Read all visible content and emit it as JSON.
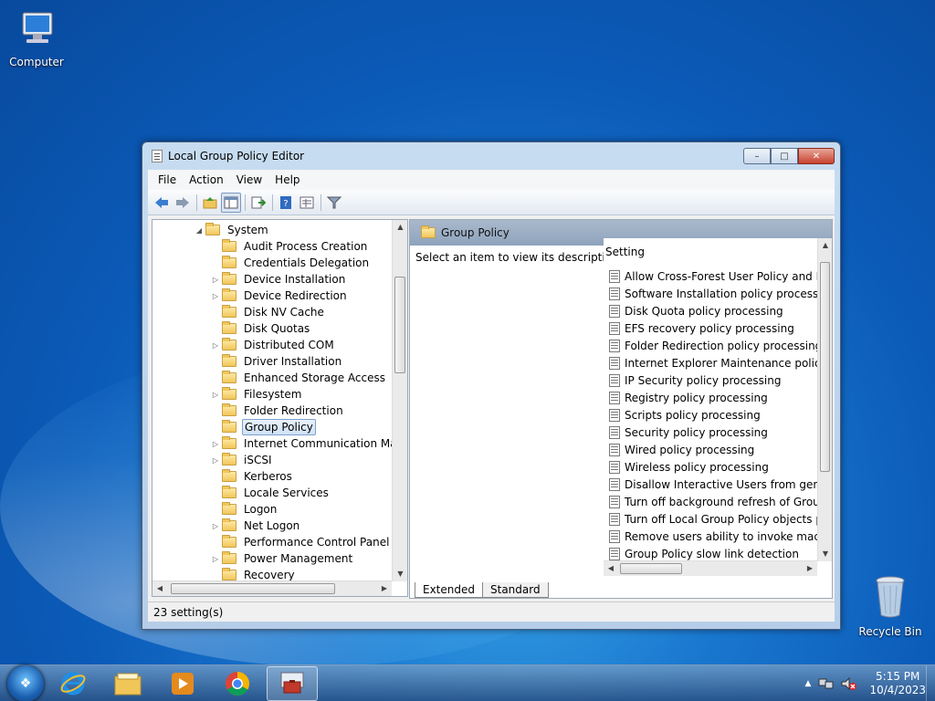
{
  "desktop": {
    "icons": [
      {
        "label": "Computer"
      },
      {
        "label": "Recycle Bin"
      }
    ]
  },
  "window": {
    "title": "Local Group Policy Editor",
    "buttons": {
      "minimize": "–",
      "maximize": "□",
      "close": "✕"
    },
    "menu": [
      "File",
      "Action",
      "View",
      "Help"
    ],
    "toolbar_icons": [
      "back-arrow-icon",
      "forward-arrow-icon",
      "up-folder-icon",
      "show-hide-console-tree-icon",
      "export-list-icon",
      "help-icon",
      "properties-icon",
      "filter-icon"
    ]
  },
  "tree": {
    "root": "System",
    "items": [
      {
        "label": "Audit Process Creation",
        "expandable": false
      },
      {
        "label": "Credentials Delegation",
        "expandable": false
      },
      {
        "label": "Device Installation",
        "expandable": true
      },
      {
        "label": "Device Redirection",
        "expandable": true
      },
      {
        "label": "Disk NV Cache",
        "expandable": false
      },
      {
        "label": "Disk Quotas",
        "expandable": false
      },
      {
        "label": "Distributed COM",
        "expandable": true
      },
      {
        "label": "Driver Installation",
        "expandable": false
      },
      {
        "label": "Enhanced Storage Access",
        "expandable": false
      },
      {
        "label": "Filesystem",
        "expandable": true
      },
      {
        "label": "Folder Redirection",
        "expandable": false
      },
      {
        "label": "Group Policy",
        "expandable": false,
        "selected": true
      },
      {
        "label": "Internet Communication Man",
        "expandable": true
      },
      {
        "label": "iSCSI",
        "expandable": true
      },
      {
        "label": "Kerberos",
        "expandable": false
      },
      {
        "label": "Locale Services",
        "expandable": false
      },
      {
        "label": "Logon",
        "expandable": false
      },
      {
        "label": "Net Logon",
        "expandable": true
      },
      {
        "label": "Performance Control Panel",
        "expandable": false
      },
      {
        "label": "Power Management",
        "expandable": true
      },
      {
        "label": "Recovery",
        "expandable": false
      }
    ]
  },
  "details": {
    "header": "Group Policy",
    "description": "Select an item to view its description.",
    "column": "Setting",
    "settings": [
      "Allow Cross-Forest User Policy and Roar",
      "Software Installation policy processing",
      "Disk Quota policy processing",
      "EFS recovery policy processing",
      "Folder Redirection policy processing",
      "Internet Explorer Maintenance policy pro",
      "IP Security policy processing",
      "Registry policy processing",
      "Scripts policy processing",
      "Security policy processing",
      "Wired policy processing",
      "Wireless policy processing",
      "Disallow Interactive Users from generati",
      "Turn off background refresh of Group P",
      "Turn off Local Group Policy objects proc",
      "Remove users ability to invoke machine",
      "Group Policy slow link detection"
    ],
    "tabs": [
      "Extended",
      "Standard"
    ]
  },
  "status": "23 setting(s)",
  "taskbar": {
    "apps": [
      "windows-explorer-icon",
      "internet-explorer-icon",
      "file-explorer-icon",
      "media-player-icon",
      "chrome-icon",
      "group-policy-editor-icon"
    ],
    "time": "5:15 PM",
    "date": "10/4/2023"
  }
}
